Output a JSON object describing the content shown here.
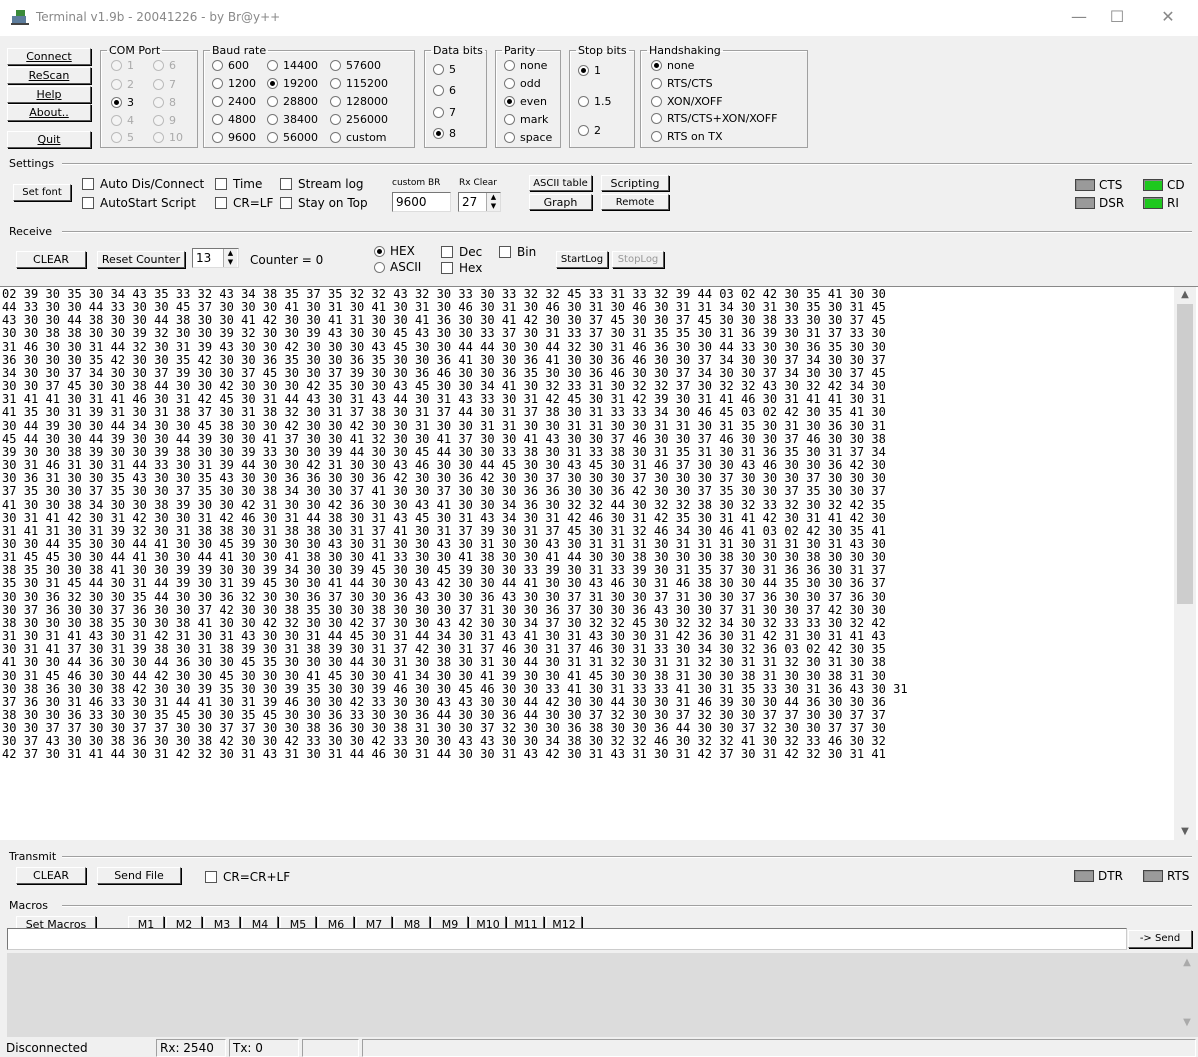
{
  "window": {
    "title": "Terminal v1.9b - 20041226 - by Br@y++",
    "min_glyph": "—",
    "max_glyph": "☐",
    "close_glyph": "✕"
  },
  "main_buttons": {
    "connect": "Connect",
    "rescan": "ReScan",
    "help": "Help",
    "about": "About..",
    "quit": "Quit"
  },
  "com_port": {
    "label": "COM Port",
    "options": [
      "1",
      "2",
      "3",
      "4",
      "5",
      "6",
      "7",
      "8",
      "9",
      "10"
    ],
    "selected": "3"
  },
  "baud_rate": {
    "label": "Baud rate",
    "options": [
      "600",
      "1200",
      "2400",
      "4800",
      "9600",
      "14400",
      "19200",
      "28800",
      "38400",
      "56000",
      "57600",
      "115200",
      "128000",
      "256000",
      "custom"
    ],
    "selected": "19200"
  },
  "data_bits": {
    "label": "Data bits",
    "options": [
      "5",
      "6",
      "7",
      "8"
    ],
    "selected": "8"
  },
  "parity": {
    "label": "Parity",
    "options": [
      "none",
      "odd",
      "even",
      "mark",
      "space"
    ],
    "selected": "even"
  },
  "stop_bits": {
    "label": "Stop bits",
    "options": [
      "1",
      "1.5",
      "2"
    ],
    "selected": "1"
  },
  "handshaking": {
    "label": "Handshaking",
    "options": [
      "none",
      "RTS/CTS",
      "XON/XOFF",
      "RTS/CTS+XON/XOFF",
      "RTS on TX"
    ],
    "selected": "none"
  },
  "settings": {
    "label": "Settings",
    "set_font": "Set font",
    "auto_dis_connect": "Auto Dis/Connect",
    "autostart_script": "AutoStart Script",
    "time": "Time",
    "cr_lf": "CR=LF",
    "stream_log": "Stream log",
    "stay_on_top": "Stay on Top",
    "custom_br_label": "custom BR",
    "custom_br_value": "9600",
    "rx_clear_label": "Rx Clear",
    "rx_clear_value": "27",
    "ascii_table": "ASCII table",
    "graph": "Graph",
    "scripting": "Scripting",
    "remote": "Remote",
    "leds": {
      "cts": "CTS",
      "cd": "CD",
      "dsr": "DSR",
      "ri": "RI"
    }
  },
  "receive": {
    "label": "Receive",
    "clear": "CLEAR",
    "reset_counter": "Reset Counter",
    "counter_spin": "13",
    "counter_text": "Counter = 0",
    "hex": "HEX",
    "ascii": "ASCII",
    "selected_mode": "HEX",
    "dec": "Dec",
    "hex_chk": "Hex",
    "bin": "Bin",
    "start_log": "StartLog",
    "stop_log": "StopLog",
    "lines": [
      "02 39 30 35 30 34 43 35 33 32 43 34 38 35 37 35 32 32 43 32 30 33 30 33 32 32 45 33 31 33 32 39 44 03 02 42 30 35 41 30 30",
      "44 33 30 30 44 33 30 30 45 37 30 30 30 41 30 31 30 41 30 31 30 46 30 31 30 46 30 31 30 46 30 31 31 34 30 31 30 35 30 31 45",
      "43 30 30 44 38 30 30 44 38 30 30 41 42 30 30 41 31 30 30 41 36 30 30 41 42 30 30 37 45 30 30 37 45 30 30 38 33 30 30 37 45",
      "30 30 38 38 30 30 39 32 30 30 39 32 30 30 39 43 30 30 45 43 30 30 33 37 30 31 33 37 30 31 35 35 30 31 36 39 30 31 37 33 30",
      "31 46 30 30 31 44 32 30 31 39 43 30 30 42 30 30 30 43 45 30 30 44 44 30 30 44 32 30 31 46 36 30 30 44 33 30 30 36 35 30 30",
      "36 30 30 30 35 42 30 30 35 42 30 30 36 35 30 30 36 35 30 30 36 41 30 30 36 41 30 30 36 46 30 30 37 34 30 30 37 34 30 30 37",
      "34 30 30 37 34 30 30 37 39 30 30 37 45 30 30 37 39 30 30 36 46 30 30 36 35 30 30 36 46 30 30 37 34 30 30 37 34 30 30 37 45",
      "30 30 37 45 30 30 38 44 30 30 42 30 30 30 42 35 30 30 43 45 30 30 34 41 30 32 33 31 30 32 32 37 30 32 32 43 30 32 42 34 30",
      "31 41 41 30 31 41 46 30 31 42 45 30 31 44 43 30 31 43 44 30 31 43 33 30 31 42 45 30 31 42 39 30 31 41 46 30 31 41 41 30 31",
      "41 35 30 31 39 31 30 31 38 37 30 31 38 32 30 31 37 38 30 31 37 44 30 31 37 38 30 31 33 33 34 30 46 45 03 02 42 30 35 41 30",
      "30 44 39 30 30 44 34 30 30 45 38 30 30 42 30 30 42 30 30 31 30 30 31 31 30 30 31 31 30 30 31 31 30 31 35 30 31 30 36 30 31",
      "45 44 30 30 44 39 30 30 44 39 30 30 41 37 30 30 41 32 30 30 41 37 30 30 41 43 30 30 37 46 30 30 37 46 30 30 37 46 30 30 38",
      "39 30 30 38 39 30 30 39 38 30 30 39 33 30 30 39 44 30 30 45 44 30 30 33 38 30 31 33 38 30 31 35 31 30 31 36 35 30 31 37 34",
      "30 31 46 31 30 31 44 33 30 31 39 44 30 30 42 31 30 30 43 46 30 30 44 45 30 30 43 45 30 31 46 37 30 30 43 46 30 30 36 42 30",
      "30 36 31 30 30 35 43 30 30 35 43 30 30 36 36 30 30 36 42 30 30 36 42 30 30 37 30 30 30 37 30 30 30 37 30 30 30 37 30 30 30",
      "37 35 30 30 37 35 30 30 37 35 30 30 38 34 30 30 37 41 30 30 37 30 30 30 36 36 30 30 36 42 30 30 37 35 30 30 37 35 30 30 37",
      "41 30 30 38 34 30 30 38 39 30 30 42 31 30 30 42 36 30 30 43 41 30 30 34 36 30 32 32 44 30 32 32 38 30 32 33 32 30 32 42 35",
      "30 31 41 42 30 31 42 30 30 31 42 46 30 31 44 38 30 31 43 45 30 31 43 34 30 31 42 46 30 31 42 35 30 31 41 42 30 31 41 42 30",
      "31 41 31 30 31 39 32 30 31 38 38 30 31 38 38 30 31 37 41 30 31 37 39 30 31 37 45 30 31 32 46 34 30 46 41 03 02 42 30 35 41",
      "30 30 44 35 30 30 44 41 30 30 45 39 30 30 30 43 30 31 30 30 43 30 31 30 30 43 30 31 31 31 30 31 31 31 30 31 31 30 31 43 30",
      "31 45 45 30 30 44 41 30 30 44 41 30 30 41 38 30 30 41 33 30 30 41 38 30 30 41 44 30 30 38 30 30 30 38 30 30 30 38 30 30 30",
      "38 35 30 30 38 41 30 30 39 39 30 30 39 34 30 30 39 45 30 30 45 39 30 30 33 39 30 31 33 39 30 31 35 37 30 31 36 36 30 31 37",
      "35 30 31 45 44 30 31 44 39 30 31 39 45 30 30 41 44 30 30 43 42 30 30 44 41 30 30 43 46 30 31 46 38 30 30 44 35 30 30 36 37",
      "30 30 36 32 30 30 35 44 30 30 36 32 30 30 36 37 30 30 36 43 30 30 36 43 30 30 37 31 30 30 37 31 30 30 37 36 30 30 37 36 30",
      "30 37 36 30 30 37 36 30 30 37 42 30 30 38 35 30 30 38 30 30 30 37 31 30 30 36 37 30 30 36 43 30 30 37 31 30 30 37 42 30 30",
      "38 30 30 30 38 35 30 30 38 41 30 30 42 32 30 30 42 37 30 30 43 42 30 30 34 37 30 32 32 45 30 32 32 34 30 32 33 33 30 32 42",
      "31 30 31 41 43 30 31 42 31 30 31 43 30 30 31 44 45 30 31 44 34 30 31 43 41 30 31 43 30 30 31 42 36 30 31 42 31 30 31 41 43",
      "30 31 41 37 30 31 39 38 30 31 38 39 30 31 38 39 30 31 37 42 30 31 37 46 30 31 37 46 30 31 33 30 34 30 32 36 03 02 42 30 35",
      "41 30 30 44 36 30 30 44 36 30 30 45 35 30 30 30 44 30 31 30 38 30 31 30 44 30 31 31 32 30 31 31 32 30 31 31 32 30 31 30 38",
      "30 31 45 46 30 30 44 42 30 30 45 30 30 30 41 45 30 30 41 34 30 30 41 39 30 30 41 45 30 30 38 31 30 30 38 31 30 30 38 31 30",
      "30 38 36 30 30 38 42 30 30 39 35 30 30 39 35 30 30 39 46 30 30 45 46 30 30 33 41 30 31 33 33 41 30 31 35 33 30 31 36 43 30 31",
      "37 36 30 31 46 33 30 31 44 41 30 31 39 46 30 30 42 33 30 30 43 43 30 30 44 42 30 30 44 30 30 31 46 39 30 30 44 36 30 30 36",
      "38 30 30 36 33 30 30 35 45 30 30 35 45 30 30 36 33 30 30 36 44 30 30 36 44 30 30 37 32 30 30 37 32 30 30 37 37 30 30 37 37",
      "30 30 37 37 30 30 37 37 30 30 37 37 30 30 38 36 30 30 38 31 30 30 37 32 30 30 36 38 30 30 36 44 30 30 37 32 30 30 37 37 30",
      "30 37 43 30 30 38 36 30 30 38 42 30 30 42 33 30 30 42 33 30 30 43 43 30 30 34 38 30 32 32 46 30 32 32 41 30 32 33 46 30 32",
      "42 37 30 31 41 44 30 31 42 32 30 31 43 31 30 31 44 46 30 31 44 30 30 31 43 42 30 31 43 31 30 31 42 37 30 31 42 32 30 31 41"
    ]
  },
  "transmit": {
    "label": "Transmit",
    "clear": "CLEAR",
    "send_file": "Send File",
    "cr_crlf": "CR=CR+LF",
    "leds": {
      "dtr": "DTR",
      "rts": "RTS"
    }
  },
  "macros": {
    "label": "Macros",
    "set_macros": "Set Macros",
    "items": [
      "M1",
      "M2",
      "M3",
      "M4",
      "M5",
      "M6",
      "M7",
      "M8",
      "M9",
      "M10",
      "M11",
      "M12"
    ]
  },
  "send": {
    "input_value": "",
    "send_button": "-> Send"
  },
  "status": {
    "connection": "Disconnected",
    "rx": "Rx: 2540",
    "tx": "Tx: 0"
  }
}
